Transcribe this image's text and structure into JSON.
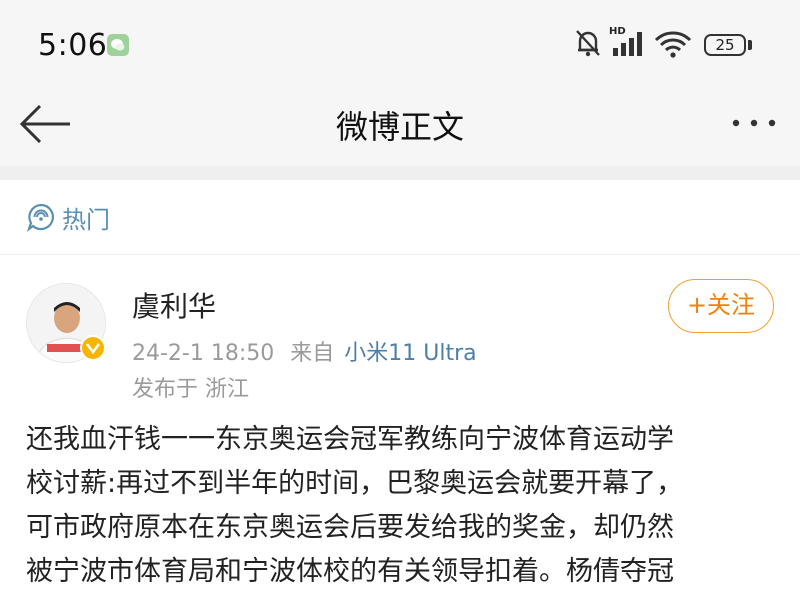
{
  "status_bar": {
    "time": "5:06",
    "hd_label": "HD",
    "battery_level": "25",
    "icons": [
      "wechat-icon",
      "mute-bell-icon",
      "signal-icon",
      "wifi-icon",
      "battery-icon"
    ]
  },
  "nav": {
    "back_icon": "back-arrow-icon",
    "title": "微博正文",
    "more_icon": "more-dots-icon"
  },
  "hot_section": {
    "icon": "hot-chat-icon",
    "label": "热门"
  },
  "post": {
    "author_name": "虞利华",
    "follow_label": "+关注",
    "timestamp": "24-2-1 18:50",
    "source_prefix": "来自",
    "device": "小米11 Ultra",
    "location": "发布于 浙江",
    "body_lines": [
      "还我血汗钱一一东京奥运会冠军教练向宁波体育运动学",
      "校讨薪:再过不到半年的时间，巴黎奥运会就要开幕了，",
      "可市政府原本在东京奥运会后要发给我的奖金，却仍然",
      "被宁波市体育局和宁波体校的有关领导扣着。杨倩夺冠"
    ]
  },
  "colors": {
    "link_blue": "#4e7fa6",
    "follow_orange": "#f08010",
    "verified_gold": "#f7b500",
    "bar_bg": "#f6f6f6"
  }
}
